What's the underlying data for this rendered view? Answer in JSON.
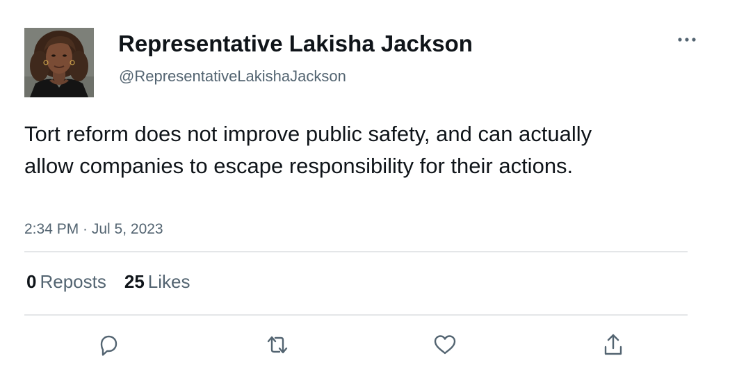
{
  "author": {
    "display_name": "Representative Lakisha Jackson",
    "handle": "@RepresentativeLakishaJackson"
  },
  "tweet": {
    "text": "Tort reform does not improve public safety, and can actually allow companies to escape responsibility for their actions.",
    "timestamp": "2:34 PM · Jul 5, 2023"
  },
  "stats": {
    "reposts_count": "0",
    "reposts_label": "Reposts",
    "likes_count": "25",
    "likes_label": "Likes"
  },
  "actions": {
    "reply_icon": "reply-icon",
    "repost_icon": "repost-icon",
    "like_icon": "heart-icon",
    "share_icon": "share-icon"
  },
  "colors": {
    "text_primary": "#0f1419",
    "text_secondary": "#536471",
    "divider": "#e4e6e8"
  }
}
